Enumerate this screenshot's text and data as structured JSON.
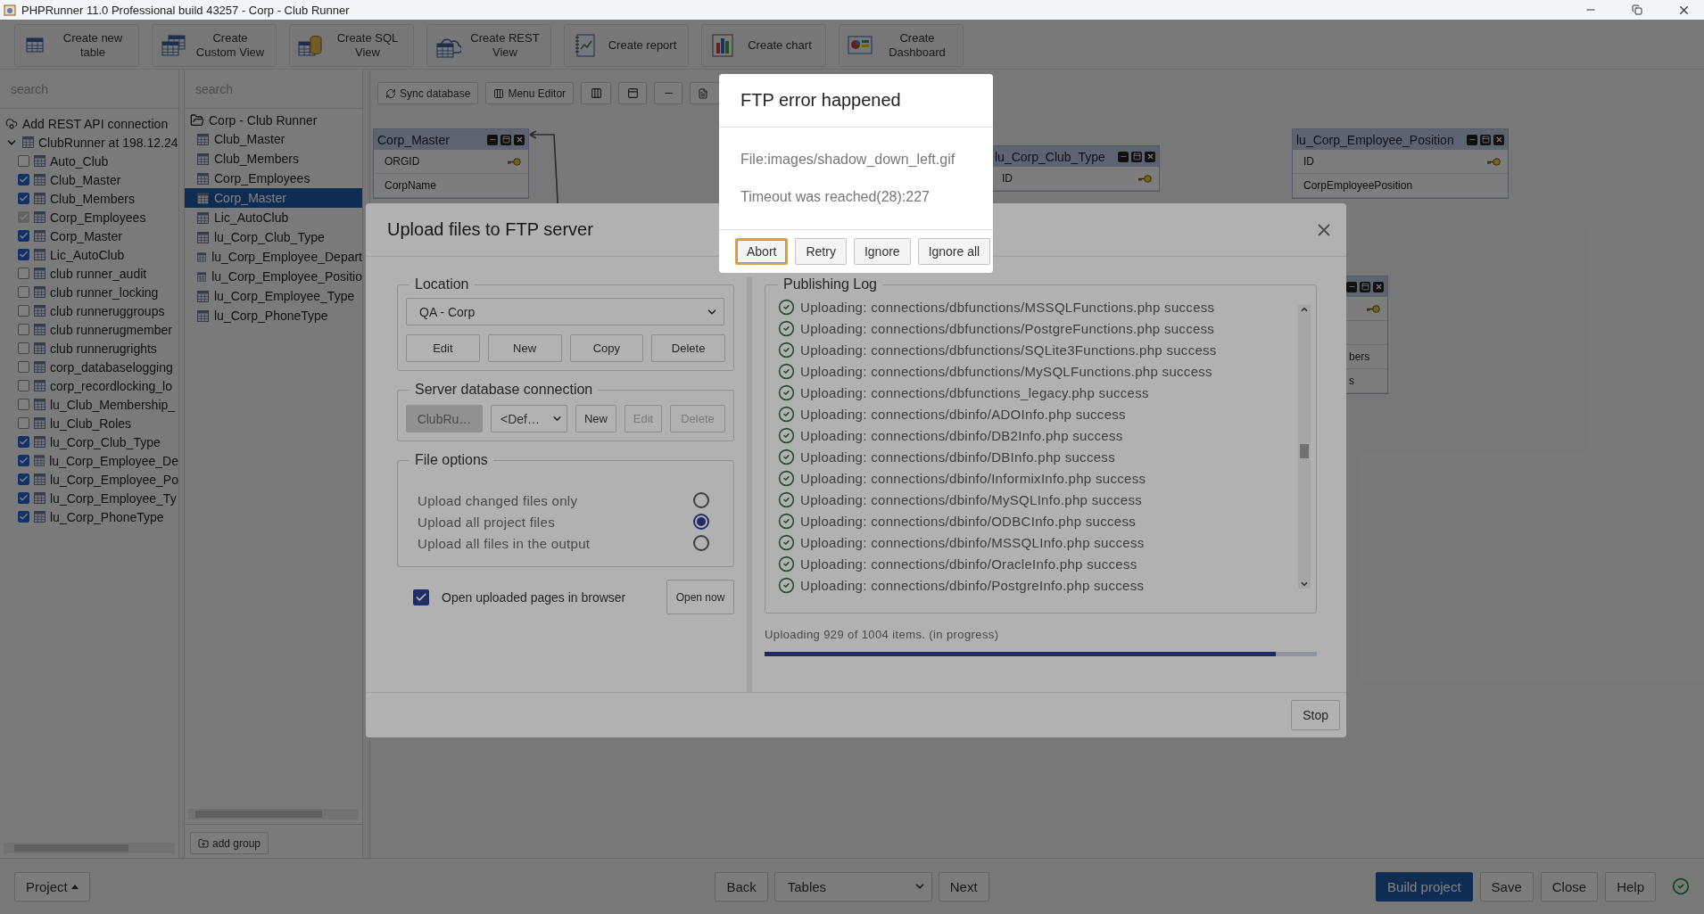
{
  "window": {
    "title": "PHPRunner 11.0 Professional build 43257 - Corp - Club Runner"
  },
  "toolbar": [
    {
      "kind": "table",
      "lines": [
        "Create new",
        "table"
      ]
    },
    {
      "kind": "views",
      "lines": [
        "Create",
        "Custom View"
      ]
    },
    {
      "kind": "sql",
      "lines": [
        "Create SQL",
        "View"
      ]
    },
    {
      "kind": "rest",
      "lines": [
        "Create REST",
        "View"
      ]
    },
    {
      "kind": "report",
      "lines": [
        "Create report"
      ]
    },
    {
      "kind": "chart",
      "lines": [
        "Create chart"
      ]
    },
    {
      "kind": "dashboard",
      "lines": [
        "Create",
        "Dashboard"
      ]
    }
  ],
  "tables_panel": {
    "search": {
      "placeholder": "search"
    },
    "add_connection": "Add REST API connection",
    "connection": {
      "label": "ClubRunner at 198.12.24",
      "expanded": true,
      "tables": [
        {
          "name": "Auto_Club",
          "checked": false,
          "disabled": false
        },
        {
          "name": "Club_Master",
          "checked": true,
          "disabled": false
        },
        {
          "name": "Club_Members",
          "checked": true,
          "disabled": false
        },
        {
          "name": "Corp_Employees",
          "checked": true,
          "disabled": true
        },
        {
          "name": "Corp_Master",
          "checked": true,
          "disabled": false
        },
        {
          "name": "Lic_AutoClub",
          "checked": true,
          "disabled": false
        },
        {
          "name": "club runner_audit",
          "checked": false,
          "disabled": false
        },
        {
          "name": "club runner_locking",
          "checked": false,
          "disabled": false
        },
        {
          "name": "club runneruggroups",
          "checked": false,
          "disabled": false
        },
        {
          "name": "club runnerugmember",
          "checked": false,
          "disabled": false
        },
        {
          "name": "club runnerugrights",
          "checked": false,
          "disabled": false
        },
        {
          "name": "corp_databaselogging",
          "checked": false,
          "disabled": false
        },
        {
          "name": "corp_recordlocking_lo",
          "checked": false,
          "disabled": false
        },
        {
          "name": "lu_Club_Membership_",
          "checked": false,
          "disabled": false
        },
        {
          "name": "lu_Club_Roles",
          "checked": false,
          "disabled": false
        },
        {
          "name": "lu_Corp_Club_Type",
          "checked": true,
          "disabled": false
        },
        {
          "name": "lu_Corp_Employee_De",
          "checked": true,
          "disabled": false
        },
        {
          "name": "lu_Corp_Employee_Po",
          "checked": true,
          "disabled": false
        },
        {
          "name": "lu_Corp_Employee_Ty",
          "checked": true,
          "disabled": false
        },
        {
          "name": "lu_Corp_PhoneType",
          "checked": true,
          "disabled": false
        }
      ]
    }
  },
  "project_panel": {
    "search": {
      "placeholder": "search"
    },
    "folder": "Corp - Club Runner",
    "tables": [
      {
        "name": "Club_Master",
        "selected": false
      },
      {
        "name": "Club_Members",
        "selected": false
      },
      {
        "name": "Corp_Employees",
        "selected": false
      },
      {
        "name": "Corp_Master",
        "selected": true
      },
      {
        "name": "Lic_AutoClub",
        "selected": false
      },
      {
        "name": "lu_Corp_Club_Type",
        "selected": false
      },
      {
        "name": "lu_Corp_Employee_Depart",
        "selected": false
      },
      {
        "name": "lu_Corp_Employee_Positio",
        "selected": false
      },
      {
        "name": "lu_Corp_Employee_Type",
        "selected": false
      },
      {
        "name": "lu_Corp_PhoneType",
        "selected": false
      }
    ],
    "add_group": "add group"
  },
  "canvas": {
    "toolbar": [
      {
        "kind": "sync",
        "label": "Sync database"
      },
      {
        "kind": "menu",
        "label": "Menu Editor"
      },
      {
        "kind": "columns"
      },
      {
        "kind": "panel"
      },
      {
        "kind": "minus"
      },
      {
        "kind": "page"
      }
    ],
    "tables": [
      {
        "title": "Corp_Master",
        "fields": [
          {
            "name": "ORGID",
            "key": true
          },
          {
            "name": "CorpName",
            "key": false
          }
        ]
      },
      {
        "title": "lu_Corp_Club_Type",
        "fields": [
          {
            "name": "ID",
            "key": true
          }
        ]
      },
      {
        "title": "lu_Corp_Employee_Position",
        "fields": [
          {
            "name": "ID",
            "key": true
          },
          {
            "name": "CorpEmployeePosition",
            "key": false
          }
        ]
      },
      {
        "fields": [
          {
            "key": true
          },
          {
            "key": false
          },
          {
            "name": "bers",
            "key": false
          },
          {
            "name": "s",
            "key": false
          }
        ]
      }
    ]
  },
  "bottom_bar": {
    "project": "Project",
    "back": "Back",
    "page_select": "Tables",
    "next": "Next",
    "actions": [
      {
        "label": "Build project",
        "primary": true
      },
      {
        "label": "Save",
        "primary": false
      },
      {
        "label": "Close",
        "primary": false
      },
      {
        "label": "Help",
        "primary": false
      }
    ]
  },
  "upload_dialog": {
    "title": "Upload files to FTP server",
    "location": {
      "legend": "Location",
      "value": "QA - Corp",
      "buttons": [
        "Edit",
        "New",
        "Copy",
        "Delete"
      ]
    },
    "db_connection": {
      "legend": "Server database connection",
      "connection": "ClubRu…",
      "database": "<Def…",
      "buttons": [
        {
          "label": "New",
          "disabled": false
        },
        {
          "label": "Edit",
          "disabled": true
        },
        {
          "label": "Delete",
          "disabled": true
        }
      ]
    },
    "file_options": {
      "legend": "File options",
      "options": [
        {
          "label": "Upload changed files only",
          "selected": false
        },
        {
          "label": "Upload all project files",
          "selected": true
        },
        {
          "label": "Upload all files in the output",
          "selected": false
        }
      ]
    },
    "open_in_browser": {
      "label": "Open uploaded pages in browser",
      "checked": true
    },
    "open_now": "Open now",
    "log": {
      "legend": "Publishing Log",
      "entries": [
        "Uploading: connections/dbfunctions/MSSQLFunctions.php success",
        "Uploading: connections/dbfunctions/PostgreFunctions.php success",
        "Uploading: connections/dbfunctions/SQLite3Functions.php success",
        "Uploading: connections/dbfunctions/MySQLFunctions.php success",
        "Uploading: connections/dbfunctions_legacy.php success",
        "Uploading: connections/dbinfo/ADOInfo.php success",
        "Uploading: connections/dbinfo/DB2Info.php success",
        "Uploading: connections/dbinfo/DBInfo.php success",
        "Uploading: connections/dbinfo/InformixInfo.php success",
        "Uploading: connections/dbinfo/MySQLInfo.php success",
        "Uploading: connections/dbinfo/ODBCInfo.php success",
        "Uploading: connections/dbinfo/MSSQLInfo.php success",
        "Uploading: connections/dbinfo/OracleInfo.php success",
        "Uploading: connections/dbinfo/PostgreInfo.php success"
      ]
    },
    "progress": {
      "text": "Uploading 929 of 1004 items. (in progress)",
      "level": 0.925
    },
    "stop": "Stop"
  },
  "error_dialog": {
    "title": "FTP error happened",
    "lines": [
      "File:images/shadow_down_left.gif",
      "Timeout was reached(28):227"
    ],
    "buttons": [
      {
        "label": "Abort",
        "focused": true
      },
      {
        "label": "Retry",
        "focused": false
      },
      {
        "label": "Ignore",
        "focused": false
      },
      {
        "label": "Ignore all",
        "focused": false
      }
    ]
  }
}
